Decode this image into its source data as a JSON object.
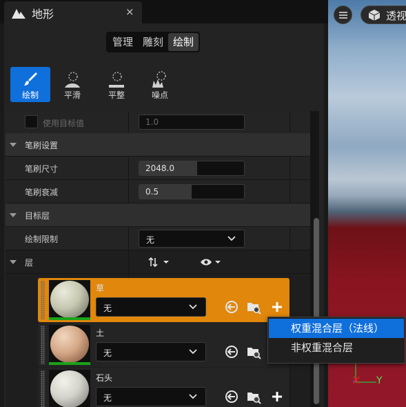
{
  "tab": {
    "title": "地形",
    "close": "×"
  },
  "modes": [
    "管理",
    "雕刻",
    "绘制"
  ],
  "tools": [
    {
      "label": "绘制",
      "icon": "brush-icon",
      "active": true
    },
    {
      "label": "平滑",
      "icon": "smooth-icon",
      "active": false
    },
    {
      "label": "平整",
      "icon": "flatten-icon",
      "active": false
    },
    {
      "label": "噪点",
      "icon": "noise-icon",
      "active": false
    }
  ],
  "details": {
    "use_target": {
      "label": "使用目标值",
      "value": "1.0"
    },
    "brush_section": "笔刷设置",
    "brush_size": {
      "label": "笔刷尺寸",
      "value": "2048.0",
      "fill": 0.55
    },
    "brush_falloff": {
      "label": "笔刷衰减",
      "value": "0.5",
      "fill": 0.5
    },
    "target_section": "目标层",
    "paint_restriction": {
      "label": "绘制限制",
      "value": "无"
    },
    "layers_section": "层"
  },
  "layers": [
    {
      "name": "草",
      "blend": "无",
      "selected": true
    },
    {
      "name": "土",
      "blend": "无",
      "selected": false
    },
    {
      "name": "石头",
      "blend": "无",
      "selected": false
    }
  ],
  "menu": {
    "items": [
      "权重混合层（法线）",
      "非权重混合层"
    ]
  },
  "viewport": {
    "perspective": "透视",
    "axis_y": "Y"
  },
  "colors": {
    "accent": "#0f6fdb",
    "selected_layer": "#e0870c",
    "layer_bar": "#1aa31a"
  }
}
